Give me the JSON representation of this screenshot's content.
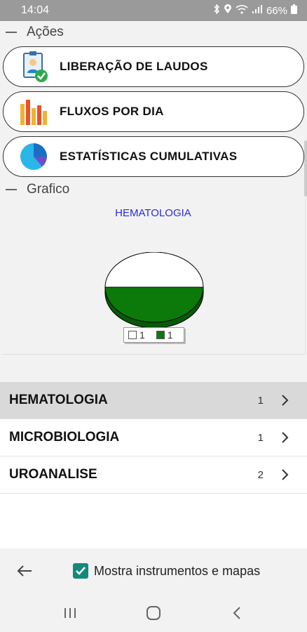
{
  "status": {
    "time": "14:04",
    "battery": "66%",
    "icons": [
      "bluetooth-icon",
      "location-icon",
      "wifi-icon",
      "signal-icon",
      "battery-icon"
    ]
  },
  "sections": {
    "acoes": "Ações",
    "grafico": "Grafico"
  },
  "actions": [
    {
      "label": "LIBERAÇÃO DE LAUDOS",
      "icon": "report-approval-icon"
    },
    {
      "label": "FLUXOS POR DIA",
      "icon": "bar-chart-icon"
    },
    {
      "label": "ESTATÍSTICAS CUMULATIVAS",
      "icon": "pie-chart-icon"
    }
  ],
  "chart_data": {
    "type": "pie",
    "title": "HEMATOLOGIA",
    "slices": [
      {
        "value": 1,
        "color": "#ffffff"
      },
      {
        "value": 1,
        "color": "#0b7a0b"
      }
    ],
    "legend": [
      "1",
      "1"
    ]
  },
  "list": [
    {
      "label": "HEMATOLOGIA",
      "count": "1",
      "selected": true
    },
    {
      "label": "MICROBIOLOGIA",
      "count": "1",
      "selected": false
    },
    {
      "label": "UROANALISE",
      "count": "2",
      "selected": false
    }
  ],
  "bottom": {
    "checkbox_label": "Mostra instrumentos e mapas",
    "checked": true
  },
  "colors": {
    "accent": "#138a7a",
    "chart_title": "#2b2bd8",
    "pie_green": "#0b7a0b"
  }
}
